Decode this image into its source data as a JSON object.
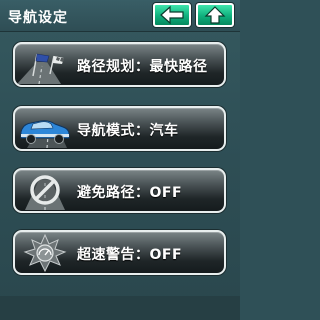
{
  "header": {
    "title": "导航设定",
    "back_icon": "left-arrow-icon",
    "up_icon": "up-arrow-icon",
    "accent_color": "#13b784"
  },
  "menu": {
    "items": [
      {
        "label": "路径规划：最快路径",
        "icon": "route-flags-icon"
      },
      {
        "label": "导航模式：汽车",
        "icon": "car-icon"
      },
      {
        "label": "避免路径：OFF",
        "icon": "no-road-icon"
      },
      {
        "label": "超速警告：OFF",
        "icon": "speed-warning-icon"
      }
    ]
  }
}
